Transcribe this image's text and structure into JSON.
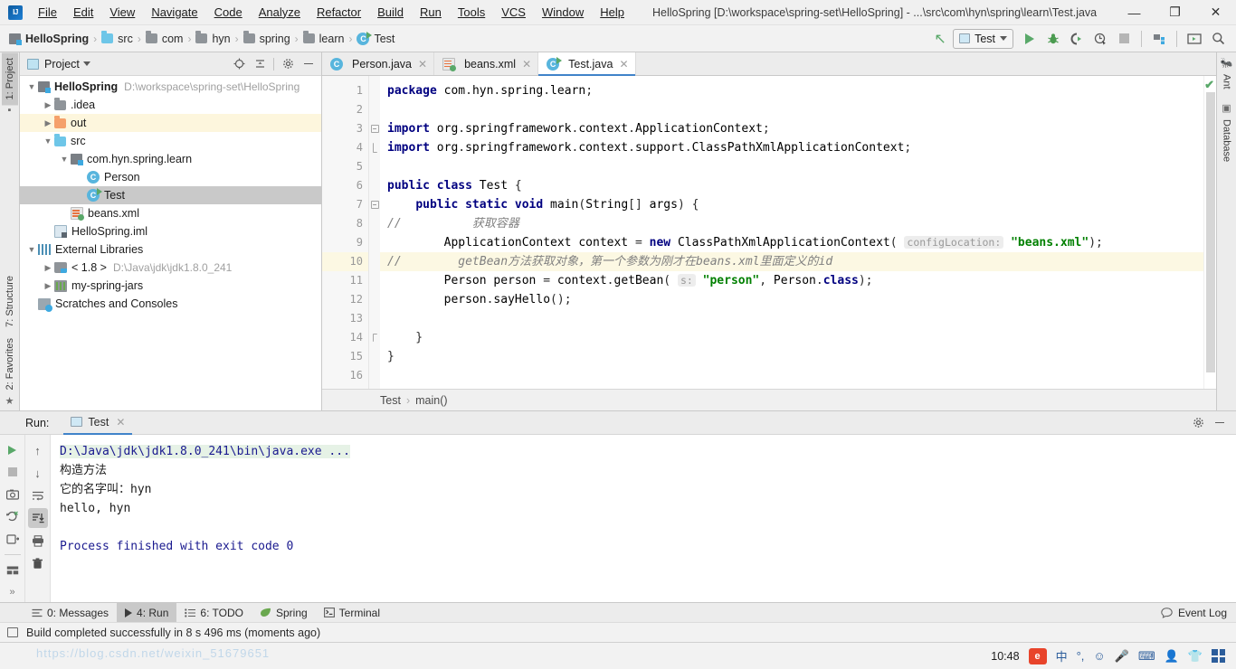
{
  "window": {
    "title": "HelloSpring [D:\\workspace\\spring-set\\HelloSpring] - ...\\src\\com\\hyn\\spring\\learn\\Test.java",
    "minimize": "—",
    "maximize": "❐",
    "close": "✕"
  },
  "menubar": [
    "File",
    "Edit",
    "View",
    "Navigate",
    "Code",
    "Analyze",
    "Refactor",
    "Build",
    "Run",
    "Tools",
    "VCS",
    "Window",
    "Help"
  ],
  "breadcrumb_nav": [
    {
      "label": "HelloSpring",
      "icon": "module-icon"
    },
    {
      "label": "src",
      "icon": "folder-blue-icon"
    },
    {
      "label": "com",
      "icon": "folder-gray-icon"
    },
    {
      "label": "hyn",
      "icon": "folder-gray-icon"
    },
    {
      "label": "spring",
      "icon": "folder-gray-icon"
    },
    {
      "label": "learn",
      "icon": "folder-gray-icon"
    },
    {
      "label": "Test",
      "icon": "class-runnable-icon"
    }
  ],
  "toolbar": {
    "back_arrow": "↖",
    "run_config": "Test",
    "run": "▶",
    "debug": "debug-icon",
    "run_coverage": "coverage-icon",
    "profile": "profile-icon",
    "stop": "■",
    "project_structure": "project-structure-icon",
    "terminal": "terminal-icon",
    "search": "⌕"
  },
  "project_panel": {
    "title": "Project",
    "actions": [
      "locate-icon",
      "collapse-all-icon",
      "settings-icon",
      "hide-icon"
    ],
    "tree": [
      {
        "depth": 0,
        "arrow": "⌄",
        "icon": "module-icon",
        "label": "HelloSpring",
        "sub": "D:\\workspace\\spring-set\\HelloSpring",
        "bold": true,
        "state": "normal"
      },
      {
        "depth": 1,
        "arrow": "›",
        "icon": "folder-gray-icon",
        "label": ".idea",
        "sub": "",
        "bold": false,
        "state": "normal"
      },
      {
        "depth": 1,
        "arrow": "›",
        "icon": "folder-orange-icon",
        "label": "out",
        "sub": "",
        "bold": false,
        "state": "mark"
      },
      {
        "depth": 1,
        "arrow": "⌄",
        "icon": "folder-blue-icon",
        "label": "src",
        "sub": "",
        "bold": false,
        "state": "normal"
      },
      {
        "depth": 2,
        "arrow": "⌄",
        "icon": "package-icon",
        "label": "com.hyn.spring.learn",
        "sub": "",
        "bold": false,
        "state": "normal"
      },
      {
        "depth": 3,
        "arrow": "",
        "icon": "class-icon",
        "label": "Person",
        "sub": "",
        "bold": false,
        "state": "normal"
      },
      {
        "depth": 3,
        "arrow": "",
        "icon": "class-runnable-icon",
        "label": "Test",
        "sub": "",
        "bold": false,
        "state": "selected"
      },
      {
        "depth": 2,
        "arrow": "",
        "icon": "xml-icon",
        "label": "beans.xml",
        "sub": "",
        "bold": false,
        "state": "normal"
      },
      {
        "depth": 1,
        "arrow": "",
        "icon": "iml-icon",
        "label": "HelloSpring.iml",
        "sub": "",
        "bold": false,
        "state": "normal"
      },
      {
        "depth": 0,
        "arrow": "⌄",
        "icon": "libraries-icon",
        "label": "External Libraries",
        "sub": "",
        "bold": false,
        "state": "normal"
      },
      {
        "depth": 1,
        "arrow": "›",
        "icon": "jdk-icon",
        "label": "< 1.8 >",
        "sub": "D:\\Java\\jdk\\jdk1.8.0_241",
        "bold": false,
        "state": "normal"
      },
      {
        "depth": 1,
        "arrow": "›",
        "icon": "jar-icon",
        "label": "my-spring-jars",
        "sub": "",
        "bold": false,
        "state": "normal"
      },
      {
        "depth": 0,
        "arrow": "",
        "icon": "scratch-icon",
        "label": "Scratches and Consoles",
        "sub": "",
        "bold": false,
        "state": "normal"
      }
    ]
  },
  "editor": {
    "tabs": [
      {
        "label": "Person.java",
        "icon": "class-icon",
        "active": false
      },
      {
        "label": "beans.xml",
        "icon": "xml-icon",
        "active": false
      },
      {
        "label": "Test.java",
        "icon": "class-runnable-icon",
        "active": true
      }
    ],
    "line_numbers": [
      "1",
      "2",
      "3",
      "4",
      "5",
      "6",
      "7",
      "8",
      "9",
      "10",
      "11",
      "12",
      "13",
      "14",
      "15",
      "16"
    ],
    "lines": [
      {
        "n": 1,
        "indent": 0,
        "html": "package com.hyn.spring.learn;"
      },
      {
        "n": 2,
        "indent": 0,
        "html": ""
      },
      {
        "n": 3,
        "indent": 0,
        "html": "import org.springframework.context.ApplicationContext;"
      },
      {
        "n": 4,
        "indent": 0,
        "html": "import org.springframework.context.support.ClassPathXmlApplicationContext;"
      },
      {
        "n": 5,
        "indent": 0,
        "html": ""
      },
      {
        "n": 6,
        "indent": 0,
        "html": "public class Test {"
      },
      {
        "n": 7,
        "indent": 1,
        "html": "public static void main(String[] args) {"
      },
      {
        "n": 8,
        "indent": 0,
        "html": "//          获取容器"
      },
      {
        "n": 9,
        "indent": 2,
        "html": "ApplicationContext context = new ClassPathXmlApplicationContext( configLocation: \"beans.xml\");"
      },
      {
        "n": 10,
        "indent": 0,
        "html": "//        getBean方法获取对象，第一个参数为刚才在beans.xml里面定义的id"
      },
      {
        "n": 11,
        "indent": 2,
        "html": "Person person = context.getBean( s: \"person\", Person.class);"
      },
      {
        "n": 12,
        "indent": 2,
        "html": "person.sayHello();"
      },
      {
        "n": 13,
        "indent": 0,
        "html": ""
      },
      {
        "n": 14,
        "indent": 1,
        "html": "}"
      },
      {
        "n": 15,
        "indent": 0,
        "html": "}"
      },
      {
        "n": 16,
        "indent": 0,
        "html": ""
      }
    ],
    "inlay_hints": {
      "config_location": "configLocation:",
      "s_param": "s:"
    },
    "highlighted_line": 10,
    "inspection_status": "✔",
    "breadcrumbs": [
      "Test",
      "main()"
    ]
  },
  "run_panel": {
    "label": "Run:",
    "tab": "Test",
    "actions": [
      "settings-icon",
      "hide-icon"
    ],
    "left_tools": [
      "rerun-icon",
      "stop-icon",
      "screenshot-icon",
      "rerun-failed-icon",
      "dump-threads-icon",
      "layout-icon",
      "expand-more-icon"
    ],
    "right_tools": [
      "up-icon",
      "down-icon",
      "soft-wrap-icon",
      "scroll-to-end-icon",
      "print-icon",
      "trash-icon"
    ],
    "console": [
      {
        "text": "D:\\Java\\jdk\\jdk1.8.0_241\\bin\\java.exe ...",
        "style": "cmd"
      },
      {
        "text": "构造方法",
        "style": "out"
      },
      {
        "text": "它的名字叫：hyn",
        "style": "out"
      },
      {
        "text": "hello, hyn",
        "style": "out"
      },
      {
        "text": "",
        "style": "out"
      },
      {
        "text": "Process finished with exit code 0",
        "style": "end"
      }
    ]
  },
  "left_strip": [
    {
      "label": "1: Project",
      "icon": "project-icon",
      "active": true
    },
    {
      "label": "7: Structure",
      "icon": "structure-icon",
      "active": false
    },
    {
      "label": "2: Favorites",
      "icon": "star-icon",
      "active": false
    }
  ],
  "right_strip": [
    {
      "label": "Ant",
      "icon": "ant-icon"
    },
    {
      "label": "Database",
      "icon": "database-icon"
    }
  ],
  "tool_window_bar": {
    "buttons": [
      {
        "label": "0: Messages",
        "icon": "messages-icon",
        "active": false
      },
      {
        "label": "4: Run",
        "icon": "run-icon",
        "active": true
      },
      {
        "label": "6: TODO",
        "icon": "todo-icon",
        "active": false
      },
      {
        "label": "Spring",
        "icon": "spring-leaf-icon",
        "active": false
      },
      {
        "label": "Terminal",
        "icon": "terminal-icon",
        "active": false
      }
    ],
    "event_log": "Event Log",
    "event_log_icon": "bubble-icon"
  },
  "statusbar": {
    "icon": "layout-icon",
    "message": "Build completed successfully in 8 s 496 ms (moments ago)"
  },
  "taskbar": {
    "watermark": "https://blog.csdn.net/weixin_51679651",
    "time": "10:48",
    "tray": [
      "ie-icon",
      "ime-cn-icon",
      "punctuation-icon",
      "emoji-icon",
      "mic-icon",
      "keyboard-icon",
      "user-icon",
      "shirt-icon",
      "grid-icon"
    ],
    "ime_label": "中",
    "ie_label": "e"
  }
}
